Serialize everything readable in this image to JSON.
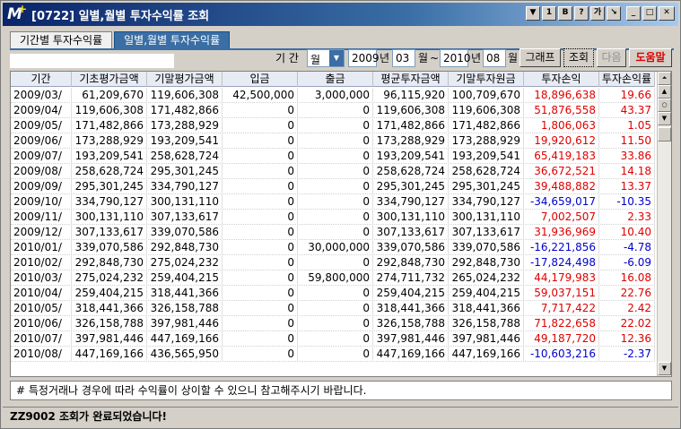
{
  "window": {
    "title": "[0722] 일별,월별 투자수익률 조회",
    "buttons": [
      "▼",
      "1",
      "B",
      "?",
      "가",
      "↘"
    ]
  },
  "tabs": [
    {
      "label": "기간별 투자수익률",
      "active": false
    },
    {
      "label": "일별,월별 투자수익률",
      "active": true
    }
  ],
  "filter": {
    "period_label": "기 간",
    "unit_value": "월",
    "start_year": "2009",
    "year_label": "년",
    "start_month": "03",
    "month_label": "월",
    "tilde": "~",
    "end_year": "2010",
    "end_month": "08",
    "chart_button": "그래프",
    "query_button": "조회",
    "next_button": "다음",
    "help_button": "도움말"
  },
  "table": {
    "columns": [
      "기간",
      "기초평가금액",
      "기말평가금액",
      "입금",
      "출금",
      "평균투자금액",
      "기말투자원금",
      "투자손익",
      "투자손익률"
    ],
    "rows": [
      [
        "2009/03/",
        "61,209,670",
        "119,606,308",
        "42,500,000",
        "3,000,000",
        "96,115,920",
        "100,709,670",
        "18,896,638",
        "19.66"
      ],
      [
        "2009/04/",
        "119,606,308",
        "171,482,866",
        "0",
        "0",
        "119,606,308",
        "119,606,308",
        "51,876,558",
        "43.37"
      ],
      [
        "2009/05/",
        "171,482,866",
        "173,288,929",
        "0",
        "0",
        "171,482,866",
        "171,482,866",
        "1,806,063",
        "1.05"
      ],
      [
        "2009/06/",
        "173,288,929",
        "193,209,541",
        "0",
        "0",
        "173,288,929",
        "173,288,929",
        "19,920,612",
        "11.50"
      ],
      [
        "2009/07/",
        "193,209,541",
        "258,628,724",
        "0",
        "0",
        "193,209,541",
        "193,209,541",
        "65,419,183",
        "33.86"
      ],
      [
        "2009/08/",
        "258,628,724",
        "295,301,245",
        "0",
        "0",
        "258,628,724",
        "258,628,724",
        "36,672,521",
        "14.18"
      ],
      [
        "2009/09/",
        "295,301,245",
        "334,790,127",
        "0",
        "0",
        "295,301,245",
        "295,301,245",
        "39,488,882",
        "13.37"
      ],
      [
        "2009/10/",
        "334,790,127",
        "300,131,110",
        "0",
        "0",
        "334,790,127",
        "334,790,127",
        "-34,659,017",
        "-10.35"
      ],
      [
        "2009/11/",
        "300,131,110",
        "307,133,617",
        "0",
        "0",
        "300,131,110",
        "300,131,110",
        "7,002,507",
        "2.33"
      ],
      [
        "2009/12/",
        "307,133,617",
        "339,070,586",
        "0",
        "0",
        "307,133,617",
        "307,133,617",
        "31,936,969",
        "10.40"
      ],
      [
        "2010/01/",
        "339,070,586",
        "292,848,730",
        "0",
        "30,000,000",
        "339,070,586",
        "339,070,586",
        "-16,221,856",
        "-4.78"
      ],
      [
        "2010/02/",
        "292,848,730",
        "275,024,232",
        "0",
        "0",
        "292,848,730",
        "292,848,730",
        "-17,824,498",
        "-6.09"
      ],
      [
        "2010/03/",
        "275,024,232",
        "259,404,215",
        "0",
        "59,800,000",
        "274,711,732",
        "265,024,232",
        "44,179,983",
        "16.08"
      ],
      [
        "2010/04/",
        "259,404,215",
        "318,441,366",
        "0",
        "0",
        "259,404,215",
        "259,404,215",
        "59,037,151",
        "22.76"
      ],
      [
        "2010/05/",
        "318,441,366",
        "326,158,788",
        "0",
        "0",
        "318,441,366",
        "318,441,366",
        "7,717,422",
        "2.42"
      ],
      [
        "2010/06/",
        "326,158,788",
        "397,981,446",
        "0",
        "0",
        "326,158,788",
        "326,158,788",
        "71,822,658",
        "22.02"
      ],
      [
        "2010/07/",
        "397,981,446",
        "447,169,166",
        "0",
        "0",
        "397,981,446",
        "397,981,446",
        "49,187,720",
        "12.36"
      ],
      [
        "2010/08/",
        "447,169,166",
        "436,565,950",
        "0",
        "0",
        "447,169,166",
        "447,169,166",
        "-10,603,216",
        "-2.37"
      ]
    ]
  },
  "note": "# 특정거래나 경우에 따라 수익률이 상이할 수 있으니 참고해주시기 바랍니다.",
  "status": "ZZ9002 조회가 완료되었습니다!",
  "colors": {
    "positive": "#e00000",
    "negative": "#0000cc",
    "accent": "#3a6ea5"
  }
}
